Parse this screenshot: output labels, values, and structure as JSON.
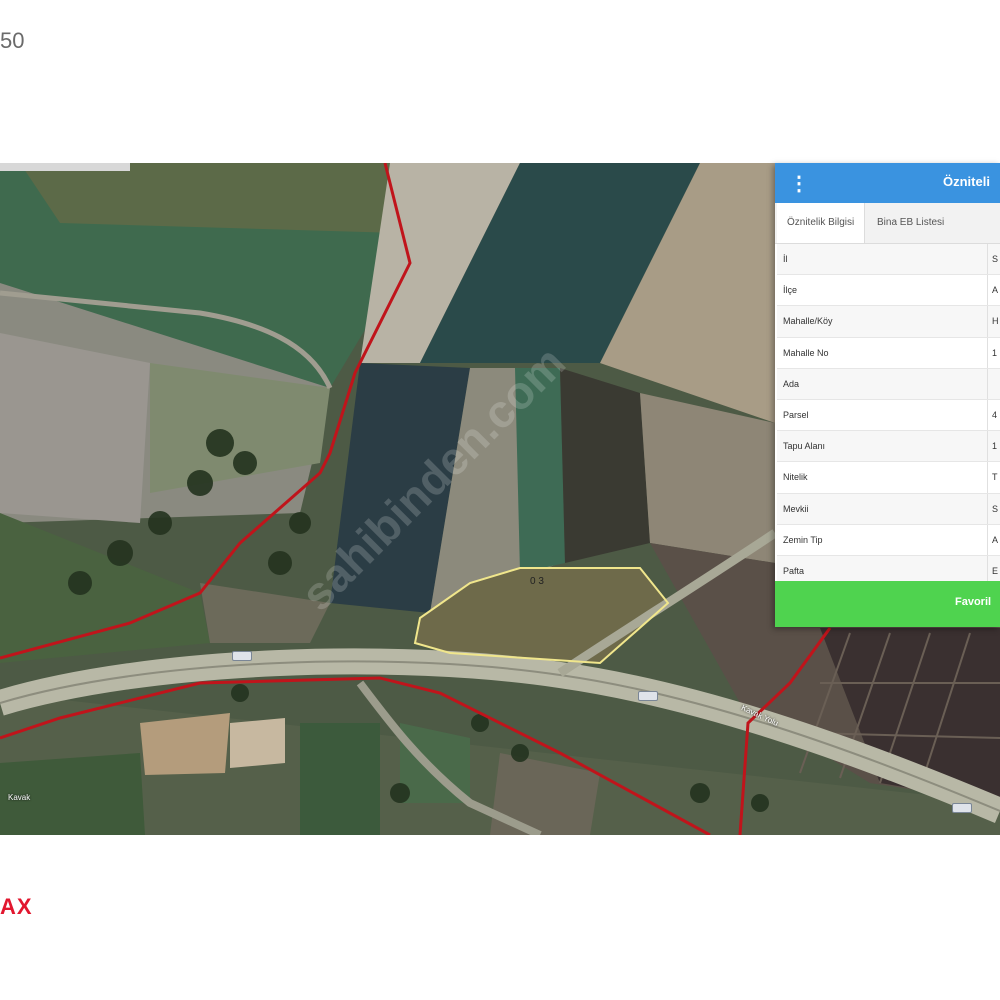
{
  "header": {
    "number_fragment": "50"
  },
  "footer": {
    "brand_fragment": "AX"
  },
  "map": {
    "parcel_label": "0 3",
    "watermark": "sahibinden.com",
    "road_label": "Kavak Yolu",
    "place_label": "Kavak"
  },
  "panel": {
    "title": "Özniteli",
    "menu_icon": "⋮",
    "tabs": [
      {
        "label": "Öznitelik Bilgisi"
      },
      {
        "label": "Bina EB Listesi"
      }
    ],
    "rows": [
      {
        "label": "İl",
        "value": "S"
      },
      {
        "label": "İlçe",
        "value": "A"
      },
      {
        "label": "Mahalle/Köy",
        "value": "H"
      },
      {
        "label": "Mahalle No",
        "value": "1"
      },
      {
        "label": "Ada",
        "value": ""
      },
      {
        "label": "Parsel",
        "value": "4"
      },
      {
        "label": "Tapu Alanı",
        "value": "1"
      },
      {
        "label": "Nitelik",
        "value": "T"
      },
      {
        "label": "Mevkii",
        "value": "S"
      },
      {
        "label": "Zemin Tip",
        "value": "A"
      },
      {
        "label": "Pafta",
        "value": "E"
      }
    ],
    "favorite_button": "Favoril"
  },
  "colors": {
    "accent_blue": "#3a93e0",
    "button_green": "#4fd34f",
    "brand_red": "#e2172f",
    "parcel_outline": "#f0e68c",
    "boundary_red": "#c0141b"
  }
}
